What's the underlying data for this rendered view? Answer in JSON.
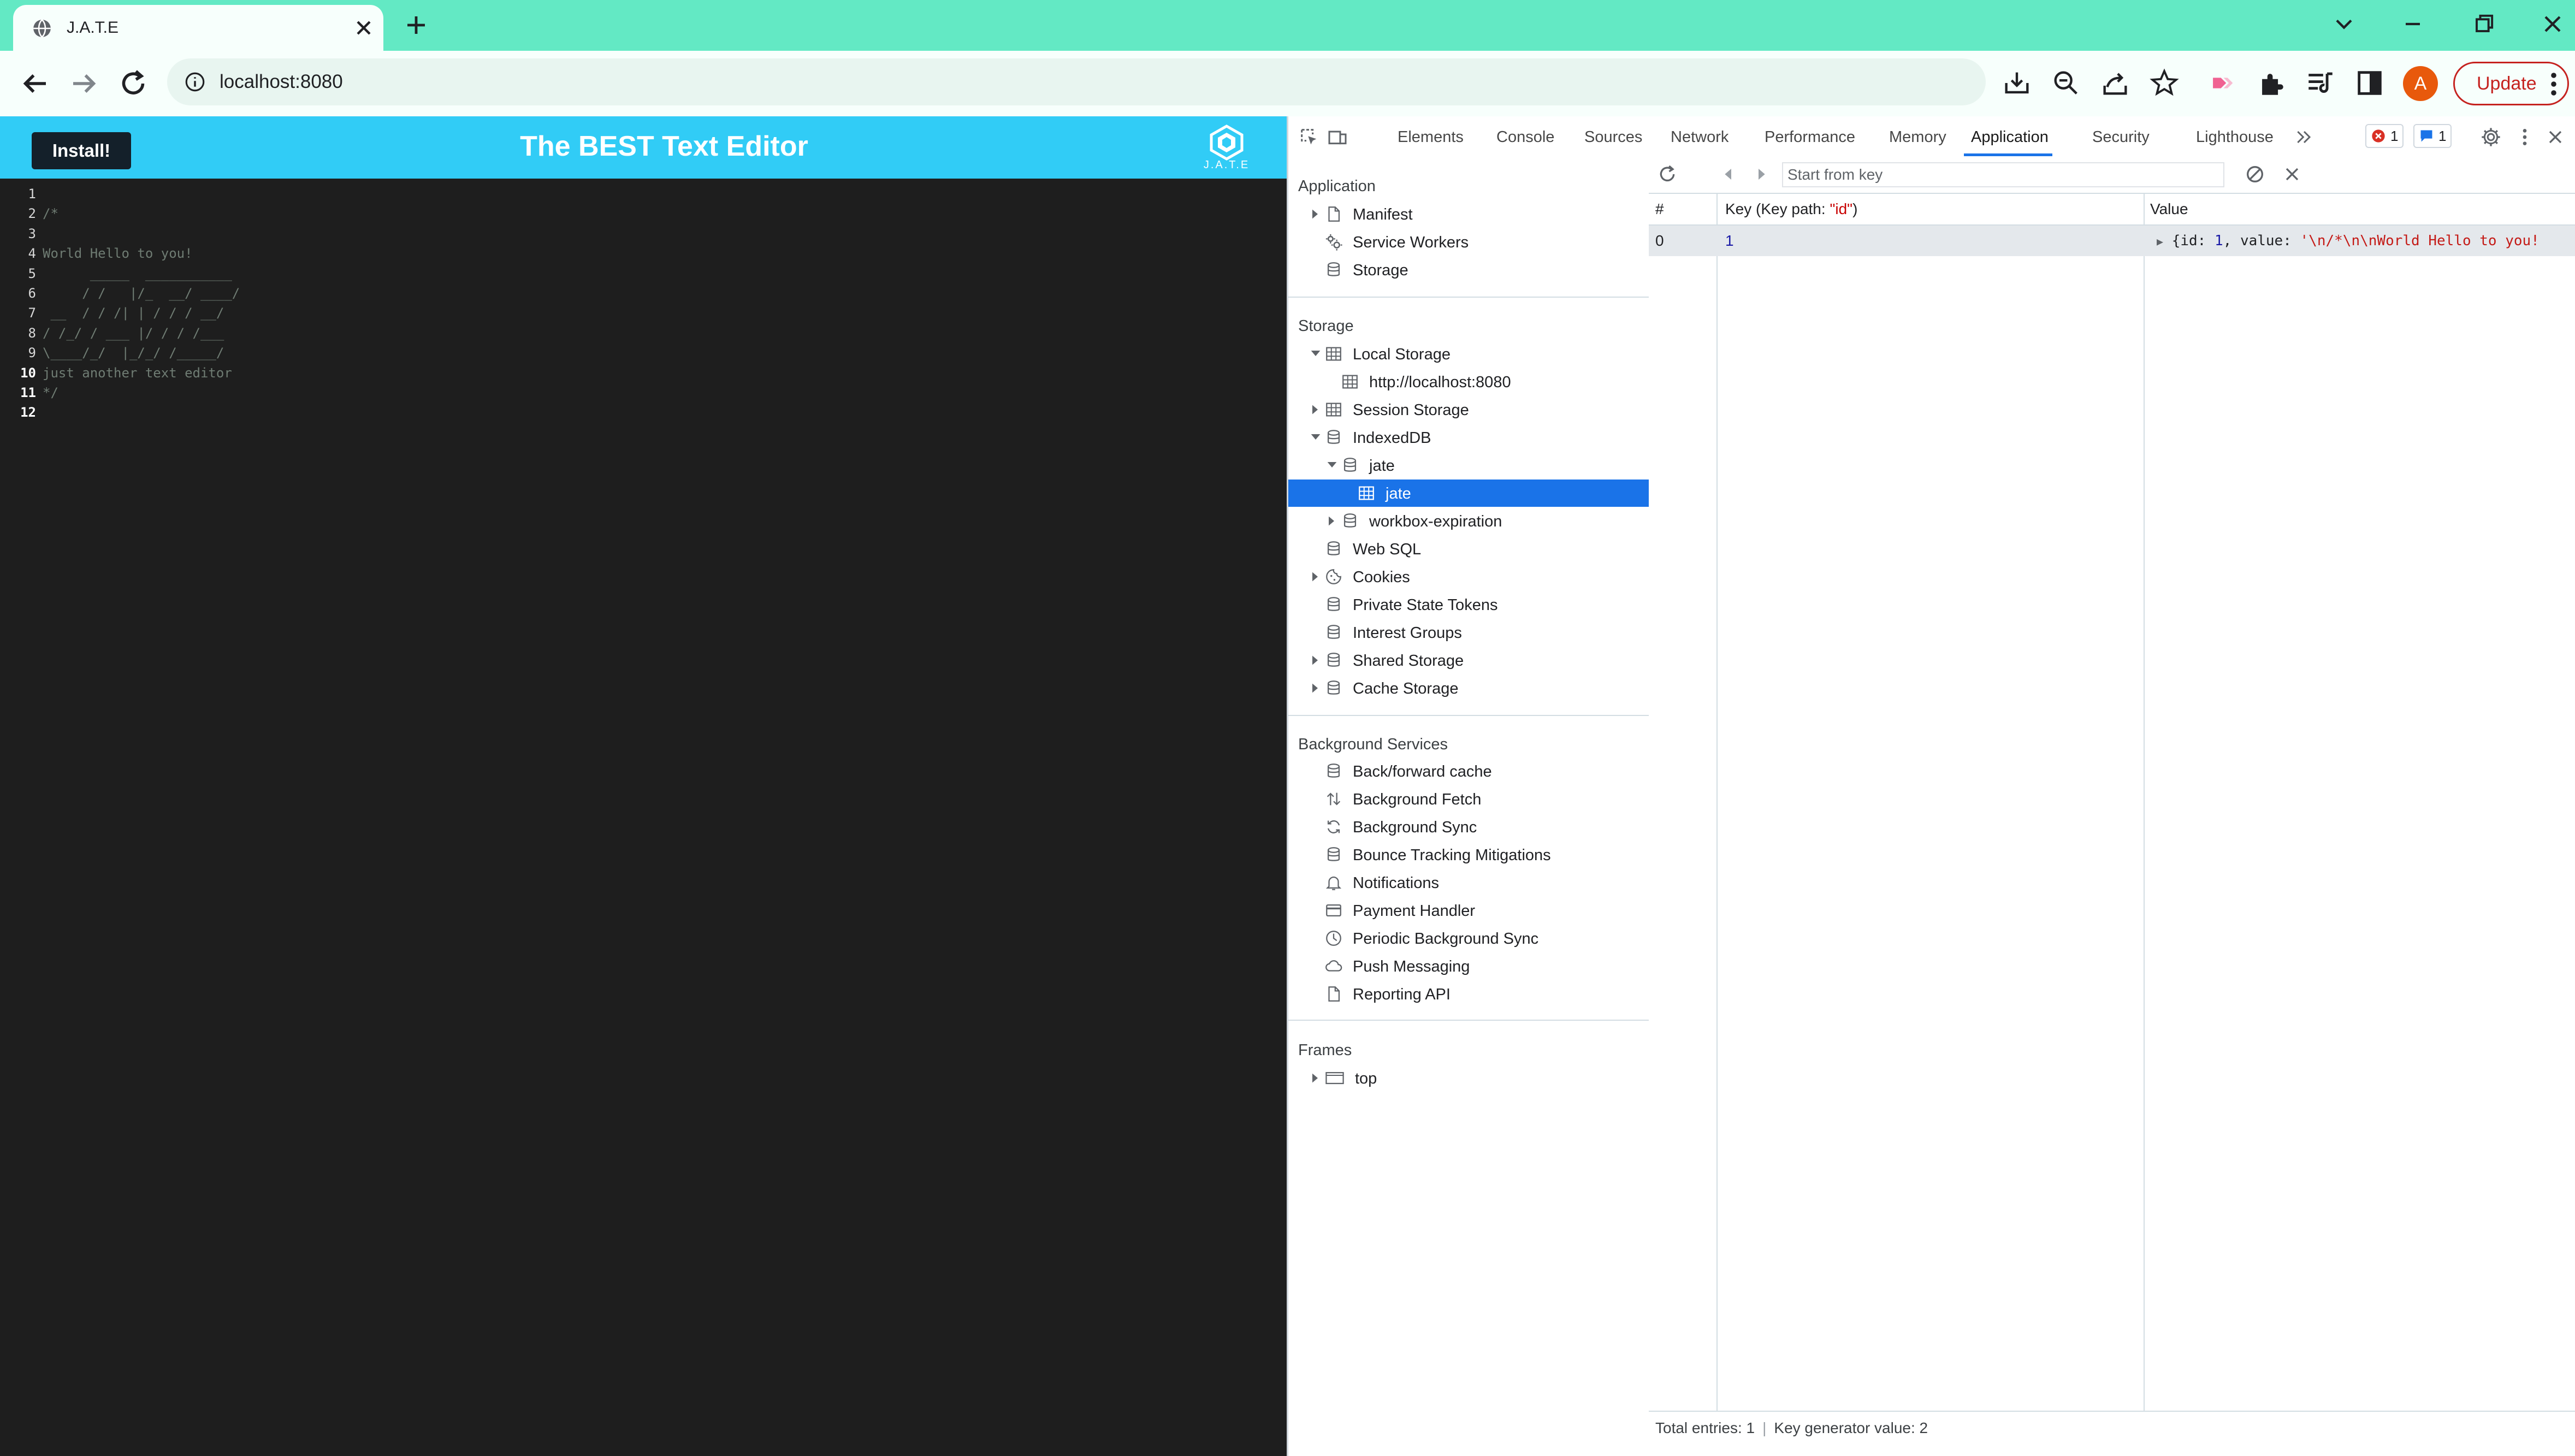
{
  "browser": {
    "tab_title": "J.A.T.E",
    "url": "localhost:8080",
    "avatar_letter": "A",
    "update_label": "Update"
  },
  "app": {
    "install_label": "Install!",
    "title": "The BEST Text Editor",
    "logo_text": "J.A.T.E",
    "editor_lines": [
      {
        "num": "1",
        "text": ""
      },
      {
        "num": "2",
        "text": "/*"
      },
      {
        "num": "3",
        "text": ""
      },
      {
        "num": "4",
        "text": "World Hello to you!"
      },
      {
        "num": "5",
        "text": "      _____  ___________"
      },
      {
        "num": "6",
        "text": "     / /   |/_  __/ ____/"
      },
      {
        "num": "7",
        "text": " __  / / /| | / / / __/"
      },
      {
        "num": "8",
        "text": "/ /_/ / ___ |/ / / /___"
      },
      {
        "num": "9",
        "text": "\\____/_/  |_/_/ /_____/"
      },
      {
        "num": "10",
        "text": "just another text editor"
      },
      {
        "num": "11",
        "text": "*/"
      },
      {
        "num": "12",
        "text": ""
      }
    ]
  },
  "devtools": {
    "tabs": [
      "Elements",
      "Console",
      "Sources",
      "Network",
      "Performance",
      "Memory",
      "Application",
      "Security",
      "Lighthouse"
    ],
    "active_tab": "Application",
    "error_count": "1",
    "message_count": "1",
    "sidebar": {
      "application_header": "Application",
      "application_items": [
        "Manifest",
        "Service Workers",
        "Storage"
      ],
      "storage_header": "Storage",
      "storage_items": [
        "Local Storage",
        "http://localhost:8080",
        "Session Storage",
        "IndexedDB",
        "jate",
        "jate",
        "workbox-expiration",
        "Web SQL",
        "Cookies",
        "Private State Tokens",
        "Interest Groups",
        "Shared Storage",
        "Cache Storage"
      ],
      "background_header": "Background Services",
      "background_items": [
        "Back/forward cache",
        "Background Fetch",
        "Background Sync",
        "Bounce Tracking Mitigations",
        "Notifications",
        "Payment Handler",
        "Periodic Background Sync",
        "Push Messaging",
        "Reporting API"
      ],
      "frames_header": "Frames",
      "frames_items": [
        "top"
      ]
    },
    "idb": {
      "start_key_placeholder": "Start from key",
      "columns": {
        "index": "#",
        "key_prefix": "Key (Key path: ",
        "key_path": "\"id\"",
        "key_suffix": ")",
        "value": "Value"
      },
      "rows": [
        {
          "index": "0",
          "key": "1",
          "value_prefix": "{id: ",
          "value_id": "1",
          "value_mid": ", value: ",
          "value_str": "'\\n/*\\n\\nWorld Hello to you!"
        }
      ],
      "footer": {
        "total_entries": "Total entries: 1",
        "key_generator": "Key generator value: 2"
      }
    }
  },
  "colors": {
    "tabbar": "#63e9c4",
    "header": "#31ccf6",
    "editor_bg": "#1e1e1e",
    "selection": "#1a73e8"
  }
}
